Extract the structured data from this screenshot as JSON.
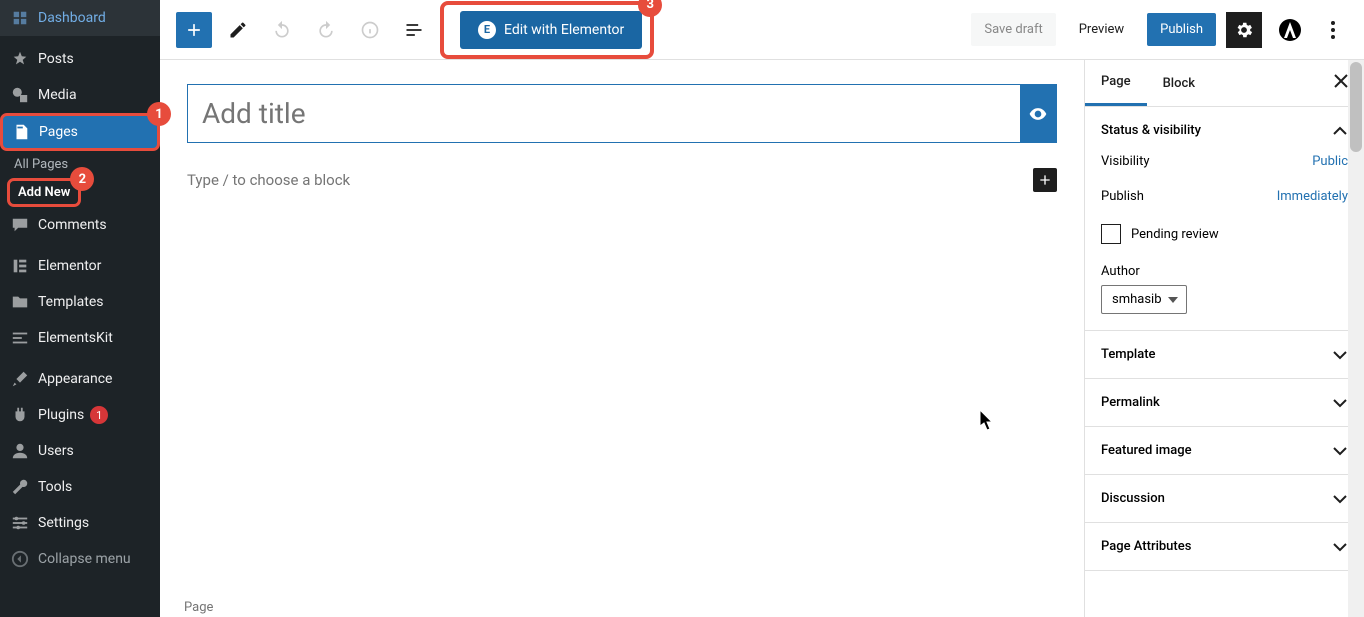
{
  "sidebar": {
    "items": [
      {
        "label": "Dashboard",
        "icon": "dashboard"
      },
      {
        "label": "Posts",
        "icon": "pin"
      },
      {
        "label": "Media",
        "icon": "media"
      },
      {
        "label": "Pages",
        "icon": "pages",
        "active": true
      },
      {
        "label": "Comments",
        "icon": "comment"
      },
      {
        "label": "Elementor",
        "icon": "elementor"
      },
      {
        "label": "Templates",
        "icon": "folder"
      },
      {
        "label": "ElementsKit",
        "icon": "ekit"
      },
      {
        "label": "Appearance",
        "icon": "brush"
      },
      {
        "label": "Plugins",
        "icon": "plug",
        "updates": "1"
      },
      {
        "label": "Users",
        "icon": "user"
      },
      {
        "label": "Tools",
        "icon": "wrench"
      },
      {
        "label": "Settings",
        "icon": "sliders"
      },
      {
        "label": "Collapse menu",
        "icon": "collapse"
      }
    ],
    "sub_items": {
      "all_pages": "All Pages",
      "add_new": "Add New"
    }
  },
  "toolbar": {
    "elementor_label": "Edit with Elementor",
    "save_draft": "Save draft",
    "preview": "Preview",
    "publish": "Publish"
  },
  "editor": {
    "title_placeholder": "Add title",
    "content_placeholder": "Type / to choose a block",
    "footer_label": "Page"
  },
  "settings_panel": {
    "tabs": {
      "page": "Page",
      "block": "Block"
    },
    "status_section": {
      "title": "Status & visibility",
      "visibility_label": "Visibility",
      "visibility_value": "Public",
      "publish_label": "Publish",
      "publish_value": "Immediately",
      "pending_label": "Pending review",
      "author_label": "Author",
      "author_value": "smhasib"
    },
    "template_title": "Template",
    "permalink_title": "Permalink",
    "featured_title": "Featured image",
    "discussion_title": "Discussion",
    "attributes_title": "Page Attributes"
  },
  "annotations": {
    "1": "1",
    "2": "2",
    "3": "3"
  }
}
